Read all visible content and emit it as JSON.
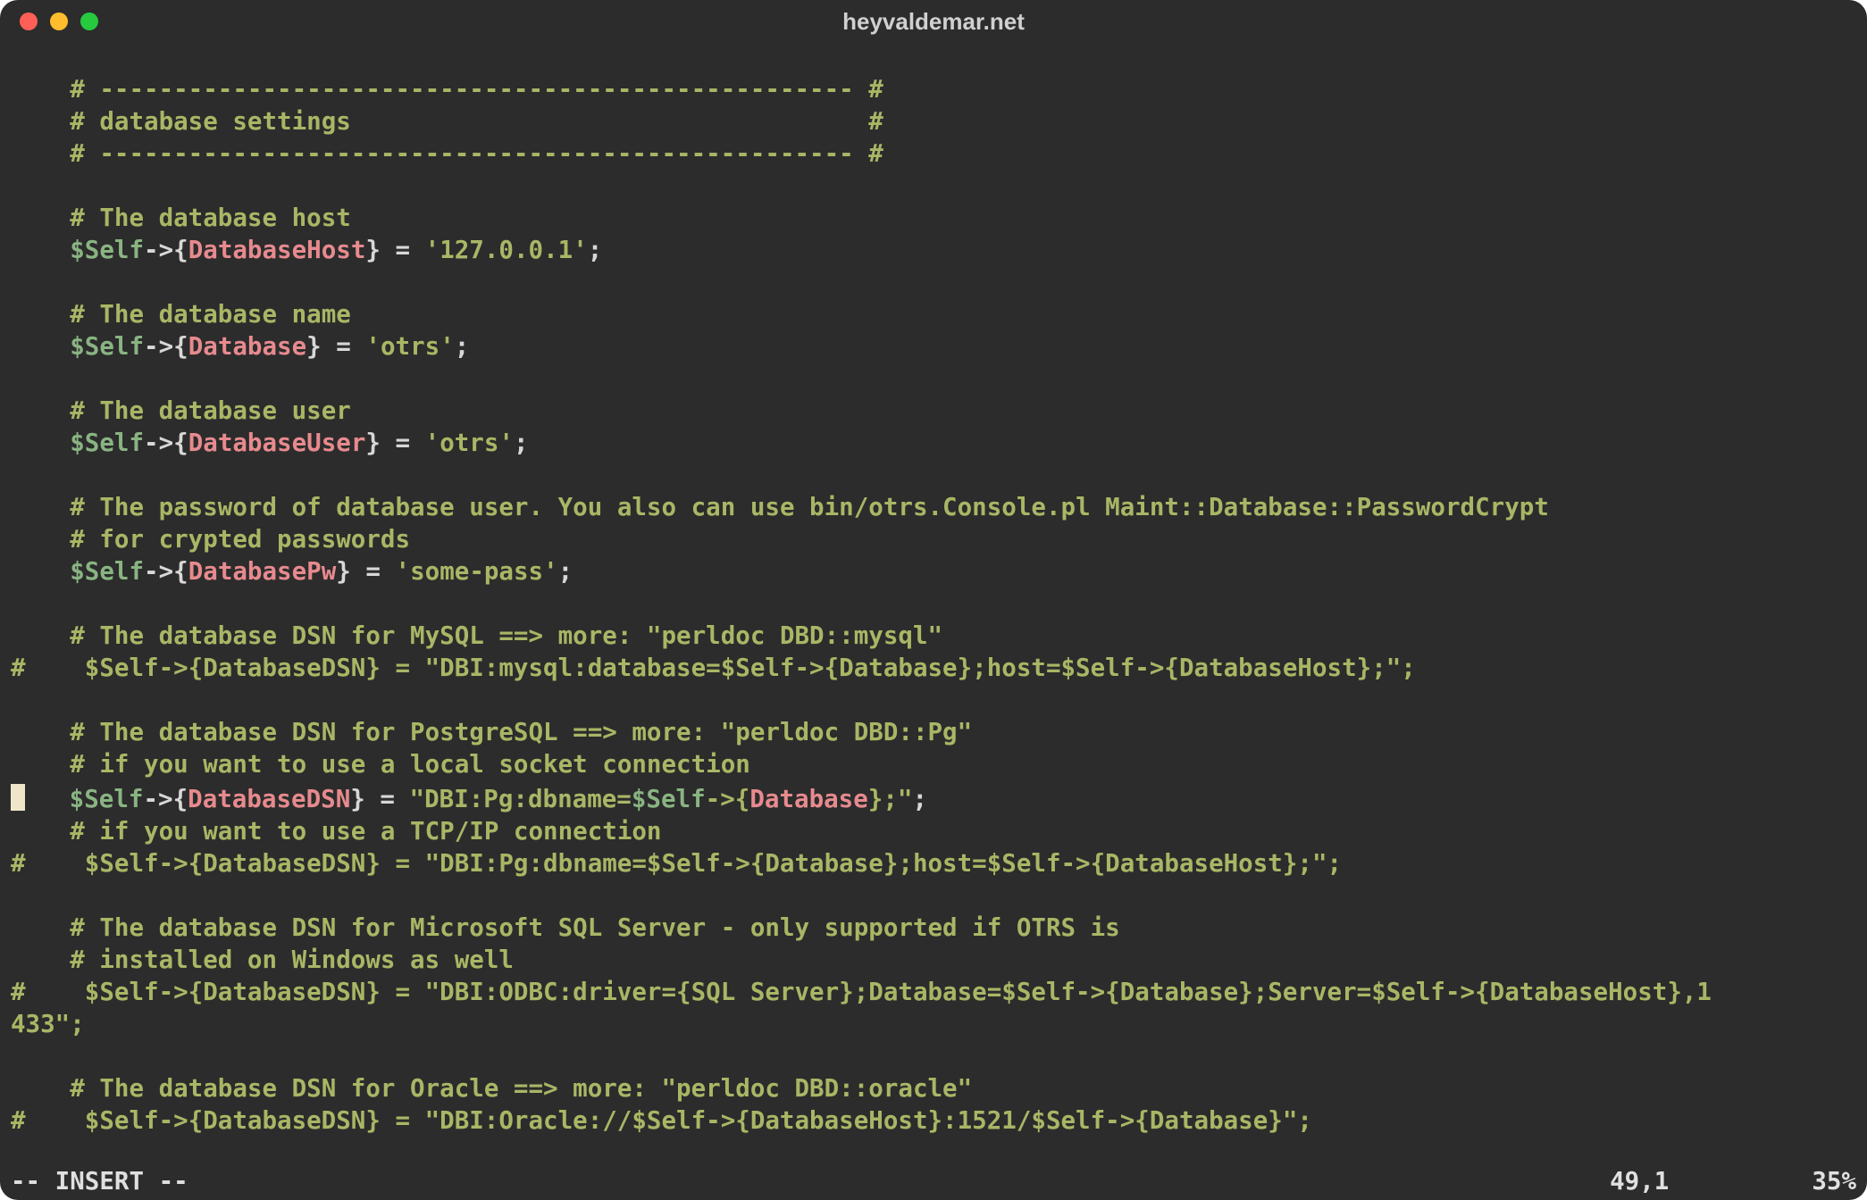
{
  "window": {
    "title": "heyvaldemar.net"
  },
  "code": {
    "indent": "    ",
    "sep_line": "# --------------------------------------------------- #",
    "header": "# database settings                                   #",
    "c_db_host": "# The database host",
    "l_db_host_key": "DatabaseHost",
    "l_db_host_val": "'127.0.0.1'",
    "c_db_name": "# The database name",
    "l_db_name_key": "Database",
    "l_db_name_val": "'otrs'",
    "c_db_user": "# The database user",
    "l_db_user_key": "DatabaseUser",
    "l_db_user_val": "'otrs'",
    "c_db_pw1": "# The password of database user. You also can use bin/otrs.Console.pl Maint::Database::PasswordCrypt",
    "c_db_pw2": "# for crypted passwords",
    "l_db_pw_key": "DatabasePw",
    "l_db_pw_val": "'some-pass'",
    "c_mysql": "# The database DSN for MySQL ==> more: \"perldoc DBD::mysql\"",
    "l_mysql": "#    $Self->{DatabaseDSN} = \"DBI:mysql:database=$Self->{Database};host=$Self->{DatabaseHost};\";",
    "c_pg": "# The database DSN for PostgreSQL ==> more: \"perldoc DBD::Pg\"",
    "c_pg_local": "# if you want to use a local socket connection",
    "l_pg_key": "DatabaseDSN",
    "l_pg_str_a": "\"DBI:Pg:dbname=",
    "l_pg_str_b": ";\"",
    "l_pg_interp_key": "Database",
    "c_pg_tcp": "# if you want to use a TCP/IP connection",
    "l_pg_tcp": "#    $Self->{DatabaseDSN} = \"DBI:Pg:dbname=$Self->{Database};host=$Self->{DatabaseHost};\";",
    "c_mssql1": "# The database DSN for Microsoft SQL Server - only supported if OTRS is",
    "c_mssql2": "# installed on Windows as well",
    "l_mssql_a": "#    $Self->{DatabaseDSN} = \"DBI:ODBC:driver={SQL Server};Database=$Self->{Database};Server=$Self->{DatabaseHost},1",
    "l_mssql_b": "433\";",
    "c_oracle": "# The database DSN for Oracle ==> more: \"perldoc DBD::oracle\"",
    "l_oracle": "#    $Self->{DatabaseDSN} = \"DBI:Oracle://$Self->{DatabaseHost}:1521/$Self->{Database}\";"
  },
  "status": {
    "mode": "-- INSERT --",
    "pos": "49,1",
    "scroll": "35%"
  },
  "self_var": "$Self"
}
